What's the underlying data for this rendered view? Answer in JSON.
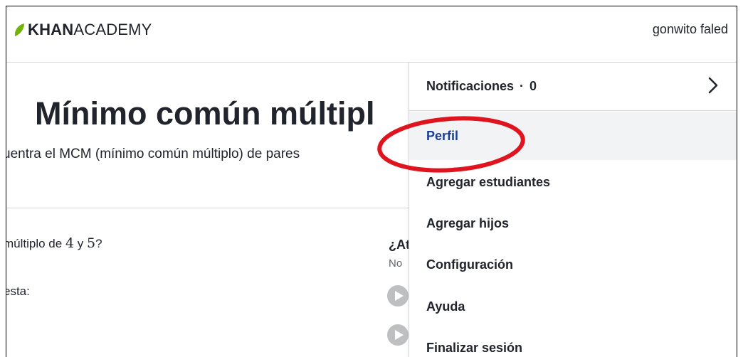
{
  "header": {
    "logo_bold": "KHAN",
    "logo_light": "ACADEMY",
    "username": "gonwito faled"
  },
  "exercise": {
    "title": "Mínimo común múltipl",
    "subtitle": "uentra el MCM (mínimo común múltiplo) de pares",
    "question_prefix": "múltiplo de",
    "question_num1": "4",
    "question_and": "y",
    "question_num2": "5",
    "question_suffix": "?",
    "answer_label": "esta:",
    "side_heading": "¿At",
    "side_sub": "No"
  },
  "dropdown": {
    "notifications_label": "Notificaciones",
    "notifications_separator": "·",
    "notifications_count": "0",
    "items": [
      {
        "label": "Perfil"
      },
      {
        "label": "Agregar estudiantes"
      },
      {
        "label": "Agregar hijos"
      },
      {
        "label": "Configuración"
      },
      {
        "label": "Ayuda"
      },
      {
        "label": "Finalizar sesión"
      }
    ]
  },
  "colors": {
    "brand_green": "#71b307",
    "highlight_link": "#1c3f93",
    "annotation_red": "#e0141e",
    "hover_bg": "#f2f3f4"
  },
  "icons": [
    "leaf-logo-icon",
    "chevron-right-icon",
    "play-icon"
  ]
}
